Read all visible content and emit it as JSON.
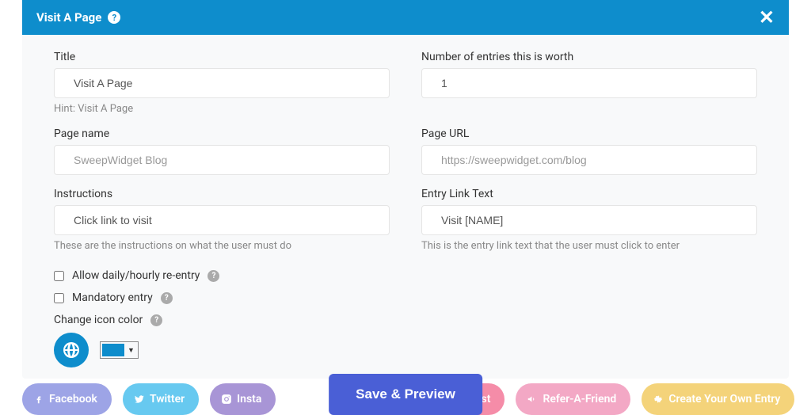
{
  "modal": {
    "title": "Visit A Page"
  },
  "form": {
    "title": {
      "label": "Title",
      "value": "Visit A Page",
      "hint": "Hint: Visit A Page"
    },
    "entries": {
      "label": "Number of entries this is worth",
      "value": "1"
    },
    "page_name": {
      "label": "Page name",
      "placeholder": "SweepWidget Blog"
    },
    "page_url": {
      "label": "Page URL",
      "placeholder": "https://sweepwidget.com/blog"
    },
    "instructions": {
      "label": "Instructions",
      "value": "Click link to visit",
      "hint": "These are the instructions on what the user must do"
    },
    "entry_link_text": {
      "label": "Entry Link Text",
      "value": "Visit [NAME]",
      "hint": "This is the entry link text that the user must click to enter"
    },
    "allow_reentry": {
      "label": "Allow daily/hourly re-entry"
    },
    "mandatory": {
      "label": "Mandatory entry"
    },
    "icon_color": {
      "label": "Change icon color",
      "color": "#0e8dcc"
    }
  },
  "save_button": "Save & Preview",
  "pills": {
    "facebook": "Facebook",
    "twitter": "Twitter",
    "instagram": "Insta",
    "pinterest": "Pinterest",
    "refer": "Refer-A-Friend",
    "custom": "Create Your Own Entry"
  },
  "colors": {
    "header": "#0e8dcc",
    "save": "#4a5fd6",
    "facebook": "#9da4e6",
    "twitter": "#67c9f0",
    "instagram": "#a895d6",
    "pinterest": "#f58ca8",
    "refer": "#f3a8c5",
    "custom": "#f4d37a"
  }
}
